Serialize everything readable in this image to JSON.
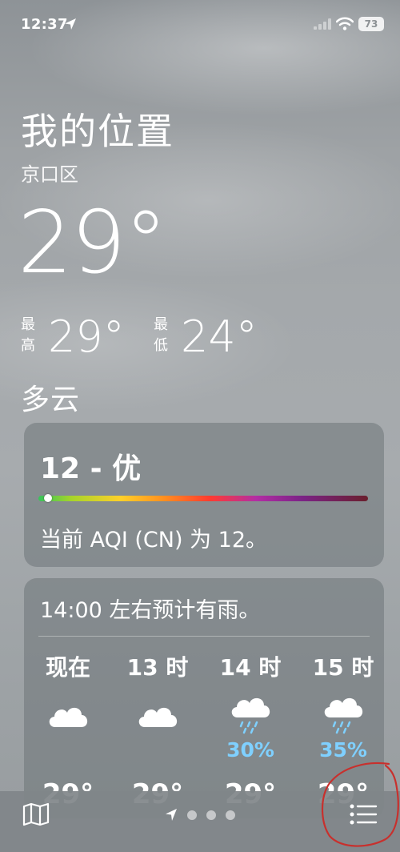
{
  "status_bar": {
    "time": "12:37",
    "battery": "73",
    "icons": [
      "location-arrow-icon",
      "signal-icon",
      "wifi-icon",
      "battery-icon"
    ]
  },
  "location": {
    "title": "我的位置",
    "district": "京口区"
  },
  "current": {
    "temperature": "29°",
    "high_label_1": "最",
    "high_label_2": "高",
    "high": "29°",
    "low_label_1": "最",
    "low_label_2": "低",
    "low": "24°",
    "condition": "多云"
  },
  "aqi": {
    "value_text": "12 - 优",
    "indicator_position": 0.03,
    "description": "当前 AQI (CN) 为 12。"
  },
  "hourly": {
    "summary": "14:00 左右预计有雨。",
    "hours": [
      {
        "label": "现在",
        "icon": "cloud-icon",
        "pop": "",
        "temp": "29°"
      },
      {
        "label": "13 时",
        "icon": "cloud-icon",
        "pop": "",
        "temp": "29°"
      },
      {
        "label": "14 时",
        "icon": "cloud-rain-icon",
        "pop": "30%",
        "temp": "29°"
      },
      {
        "label": "15 时",
        "icon": "cloud-rain-icon",
        "pop": "35%",
        "temp": "29°"
      }
    ]
  },
  "bottom_bar": {
    "icons": [
      "map-icon",
      "location-arrow-icon",
      "list-icon"
    ],
    "page_dots": 3
  },
  "colors": {
    "precip_blue": "#7fd0ff",
    "annotation_red": "#c8302d"
  }
}
